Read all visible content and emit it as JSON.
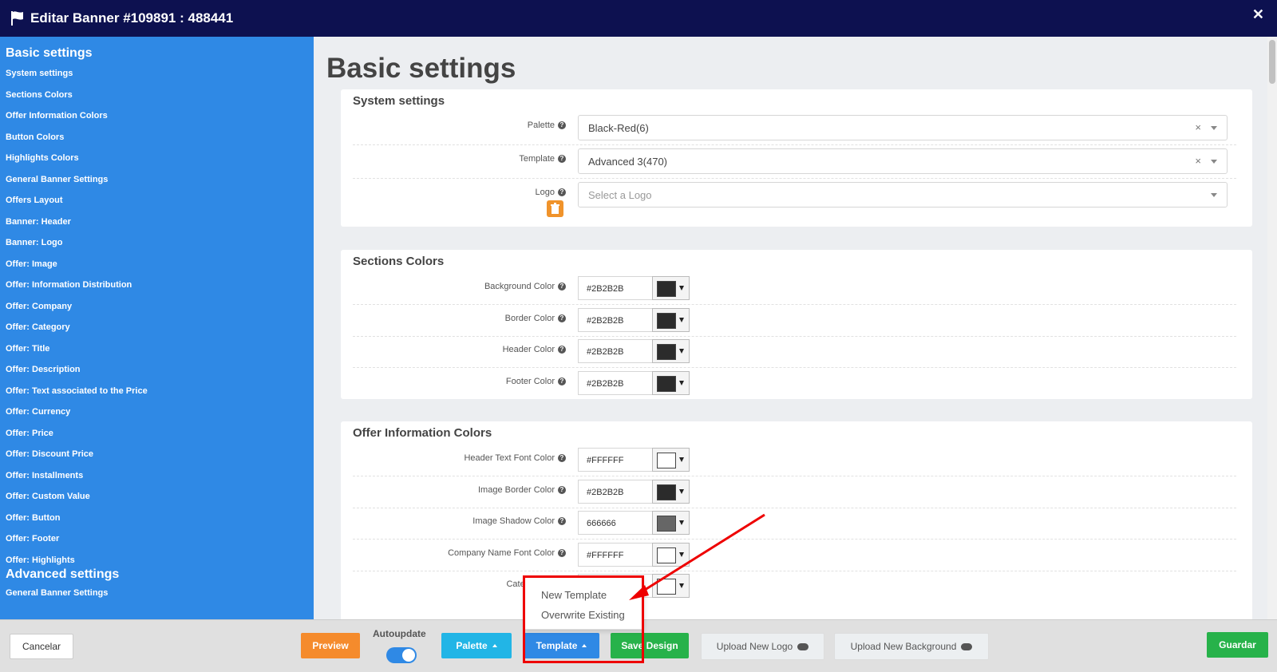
{
  "window": {
    "title": "Editar Banner #109891 : 488441"
  },
  "sidebar": {
    "basic_heading": "Basic settings",
    "items": [
      "System settings",
      "Sections Colors",
      "Offer Information Colors",
      "Button Colors",
      "Highlights Colors",
      "General Banner Settings",
      "Offers Layout",
      "Banner: Header",
      "Banner: Logo",
      "Offer: Image",
      "Offer: Information Distribution",
      "Offer: Company",
      "Offer: Category",
      "Offer: Title",
      "Offer: Description",
      "Offer: Text associated to the Price",
      "Offer: Currency",
      "Offer: Price",
      "Offer: Discount Price",
      "Offer: Installments",
      "Offer: Custom Value",
      "Offer: Button",
      "Offer: Footer",
      "Offer: Highlights"
    ],
    "advanced_heading": "Advanced settings",
    "advanced_items": [
      "General Banner Settings"
    ]
  },
  "main": {
    "heading": "Basic settings",
    "system": {
      "title": "System settings",
      "palette_label": "Palette",
      "palette_value": "Black-Red(6)",
      "template_label": "Template",
      "template_value": "Advanced 3(470)",
      "logo_label": "Logo",
      "logo_placeholder": "Select a Logo",
      "clear_symbol": "×"
    },
    "sections": {
      "title": "Sections Colors",
      "rows": [
        {
          "label": "Background Color",
          "value": "#2B2B2B",
          "swatch": "#2b2b2b"
        },
        {
          "label": "Border Color",
          "value": "#2B2B2B",
          "swatch": "#2b2b2b"
        },
        {
          "label": "Header Color",
          "value": "#2B2B2B",
          "swatch": "#2b2b2b"
        },
        {
          "label": "Footer Color",
          "value": "#2B2B2B",
          "swatch": "#2b2b2b"
        }
      ]
    },
    "offer_info": {
      "title": "Offer Information Colors",
      "rows": [
        {
          "label": "Header Text Font Color",
          "value": "#FFFFFF",
          "swatch": "#ffffff"
        },
        {
          "label": "Image Border Color",
          "value": "#2B2B2B",
          "swatch": "#2b2b2b"
        },
        {
          "label": "Image Shadow Color",
          "value": "666666",
          "swatch": "#666666"
        },
        {
          "label": "Company Name Font Color",
          "value": "#FFFFFF",
          "swatch": "#ffffff"
        },
        {
          "label": "Category Fo",
          "value": "",
          "swatch": "#ffffff"
        }
      ]
    }
  },
  "footer": {
    "cancel": "Cancelar",
    "preview": "Preview",
    "autoupdate": "Autoupdate",
    "palette": "Palette",
    "template": "Template",
    "save_design": "Save Design",
    "upload_logo": "Upload New Logo",
    "upload_background": "Upload New Background",
    "guardar": "Guardar"
  },
  "template_menu": {
    "options": [
      "New Template",
      "Overwrite Existing"
    ]
  },
  "colors": {
    "titlebar": "#0d1150",
    "sidebar": "#2f89e5",
    "highlight": "#ee0000"
  }
}
